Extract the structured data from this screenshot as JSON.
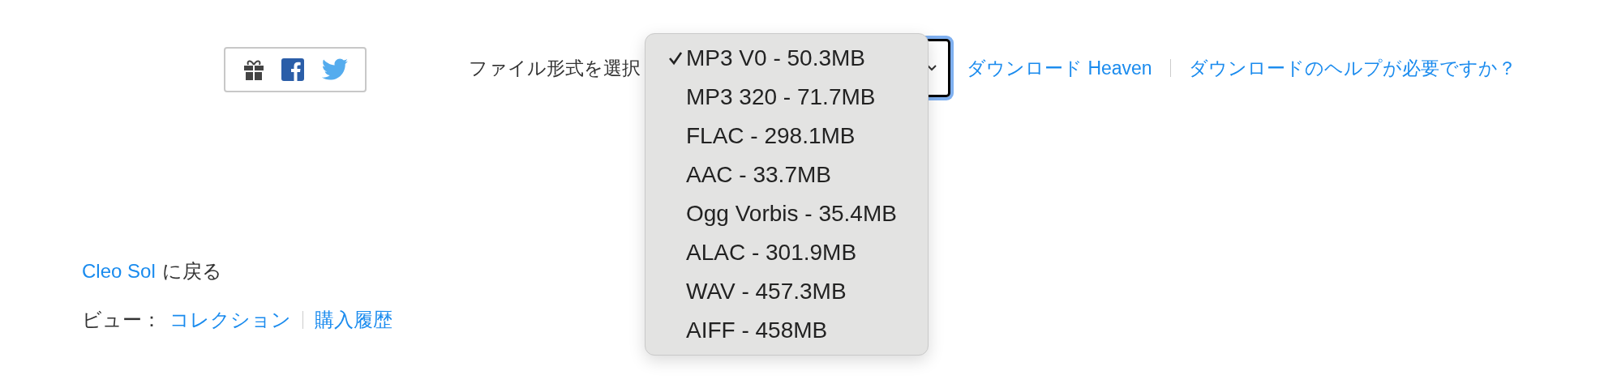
{
  "share": {
    "buttons": [
      {
        "kind": "gift"
      },
      {
        "kind": "facebook"
      },
      {
        "kind": "twitter"
      }
    ]
  },
  "format_select": {
    "label": "ファイル形式を選択",
    "expanded": true,
    "options": [
      {
        "label": "MP3 V0 - 50.3MB",
        "selected": true
      },
      {
        "label": "MP3 320 - 71.7MB",
        "selected": false
      },
      {
        "label": "FLAC - 298.1MB",
        "selected": false
      },
      {
        "label": "AAC - 33.7MB",
        "selected": false
      },
      {
        "label": "Ogg Vorbis - 35.4MB",
        "selected": false
      },
      {
        "label": "ALAC - 301.9MB",
        "selected": false
      },
      {
        "label": "WAV - 457.3MB",
        "selected": false
      },
      {
        "label": "AIFF - 458MB",
        "selected": false
      }
    ]
  },
  "download_links": [
    "ダウンロード Heaven",
    "ダウンロードのヘルプが必要ですか？"
  ],
  "back": {
    "link": "Cleo Sol",
    "text": "に戻る"
  },
  "view": {
    "label": "ビュー：",
    "links": [
      "コレクション",
      "購入履歴"
    ]
  }
}
